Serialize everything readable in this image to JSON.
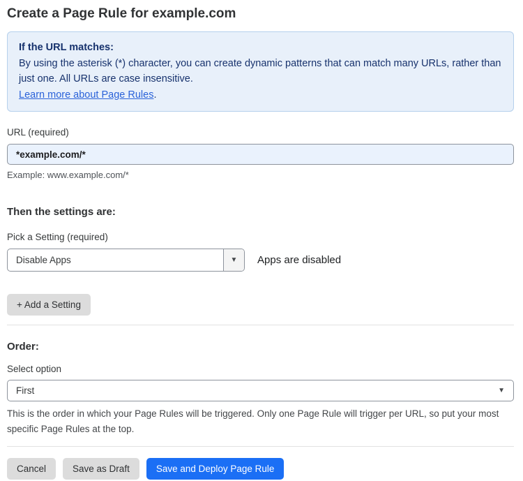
{
  "page": {
    "title": "Create a Page Rule for example.com"
  },
  "info_box": {
    "heading": "If the URL matches:",
    "body": "By using the asterisk (*) character, you can create dynamic patterns that can match many URLs, rather than just one. All URLs are case insensitive.",
    "link_label": "Learn more about Page Rules",
    "link_suffix": "."
  },
  "url_field": {
    "label": "URL (required)",
    "value": "*example.com/*",
    "example": "Example: www.example.com/*"
  },
  "settings_section": {
    "heading": "Then the settings are:",
    "picker_label": "Pick a Setting (required)",
    "selected_setting": "Disable Apps",
    "status_text": "Apps are disabled",
    "add_setting_label": "+ Add a Setting"
  },
  "order_section": {
    "heading": "Order:",
    "select_label": "Select option",
    "selected_option": "First",
    "help_text": "This is the order in which your Page Rules will be triggered. Only one Page Rule will trigger per URL, so put your most specific Page Rules at the top."
  },
  "footer": {
    "cancel_label": "Cancel",
    "save_draft_label": "Save as Draft",
    "save_deploy_label": "Save and Deploy Page Rule"
  },
  "icons": {
    "caret_down": "▼"
  },
  "colors": {
    "primary_blue": "#1b6ff5",
    "info_background": "#e8f0fa",
    "info_border": "#b5d0ec",
    "info_text": "#17326d",
    "link_blue": "#2a62d9",
    "input_background": "#eaf2fd",
    "button_gray": "#dcdcdc"
  }
}
